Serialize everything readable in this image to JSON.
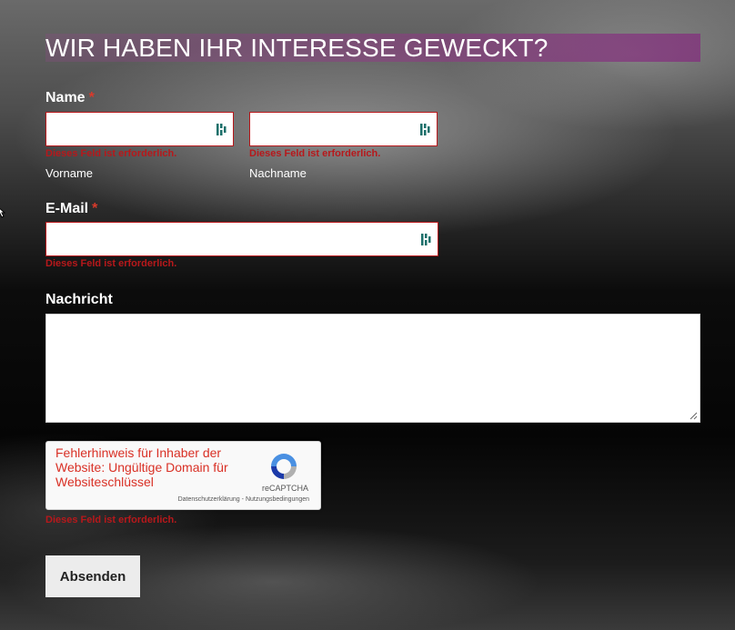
{
  "form": {
    "title": "WIR HABEN IHR INTERESSE GEWECKT?",
    "required_marker": "*",
    "error_required": "Dieses Feld ist erforderlich.",
    "name": {
      "label": "Name",
      "first_sub": "Vorname",
      "last_sub": "Nachname",
      "first_value": "",
      "last_value": ""
    },
    "email": {
      "label": "E-Mail",
      "value": ""
    },
    "message": {
      "label": "Nachricht",
      "value": ""
    },
    "recaptcha": {
      "error_text": "Fehlerhinweis für Inhaber der Website: Ungültige Domain für Websiteschlüssel",
      "brand": "reCAPTCHA",
      "privacy": "Datenschutzerklärung",
      "separator": "-",
      "terms": "Nutzungsbedingungen"
    },
    "submit_label": "Absenden"
  },
  "icons": {
    "field_icon": "password-manager-icon",
    "captcha_logo": "recaptcha-logo-icon",
    "cursor": "mouse-cursor-icon"
  },
  "colors": {
    "error": "#b7181b",
    "required": "#d93a2b",
    "heading_band": "#8c3c82",
    "icon_teal": "#1b6f6a"
  }
}
